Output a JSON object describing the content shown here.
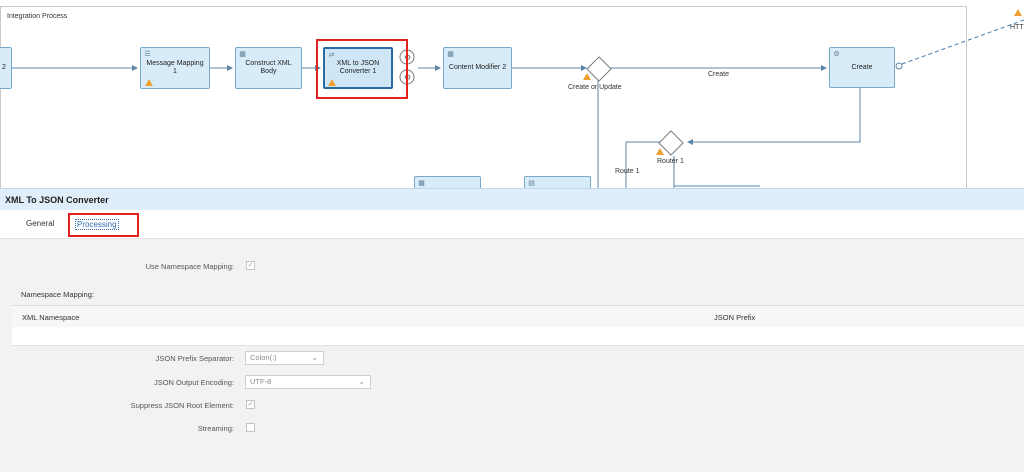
{
  "diagram": {
    "pool_title": "Integration Process",
    "steps": {
      "left_partial": "2",
      "message_mapping": "Message Mapping 1",
      "construct_xml": "Construct XML Body",
      "xml_to_json": "XML to JSON Converter 1",
      "content_modifier": "Content Modifier 2",
      "create": "Create"
    },
    "gateways": {
      "create_or_update": "Create or Update",
      "router": "Router 1"
    },
    "flow_labels": {
      "create": "Create",
      "route1": "Route 1"
    },
    "receiver_partial": "HTT"
  },
  "panel": {
    "title": "XML To JSON Converter",
    "tabs": [
      "General",
      "Processing"
    ],
    "active_tab": "Processing"
  },
  "form": {
    "use_namespace_mapping_label": "Use Namespace Mapping:",
    "namespace_mapping_label": "Namespace Mapping:",
    "table_headers": {
      "xml_namespace": "XML Namespace",
      "json_prefix": "JSON Prefix"
    },
    "json_prefix_separator_label": "JSON Prefix Separator:",
    "json_prefix_separator_value": "Colon(:)",
    "json_output_encoding_label": "JSON Output Encoding:",
    "json_output_encoding_value": "UTF-8",
    "suppress_root_label": "Suppress JSON Root Element:",
    "streaming_label": "Streaming:",
    "checkmark": "✓"
  },
  "colors": {
    "highlight": "#e0231e",
    "step_fill": "#d7ecf8",
    "accent": "#2e6ca8"
  }
}
